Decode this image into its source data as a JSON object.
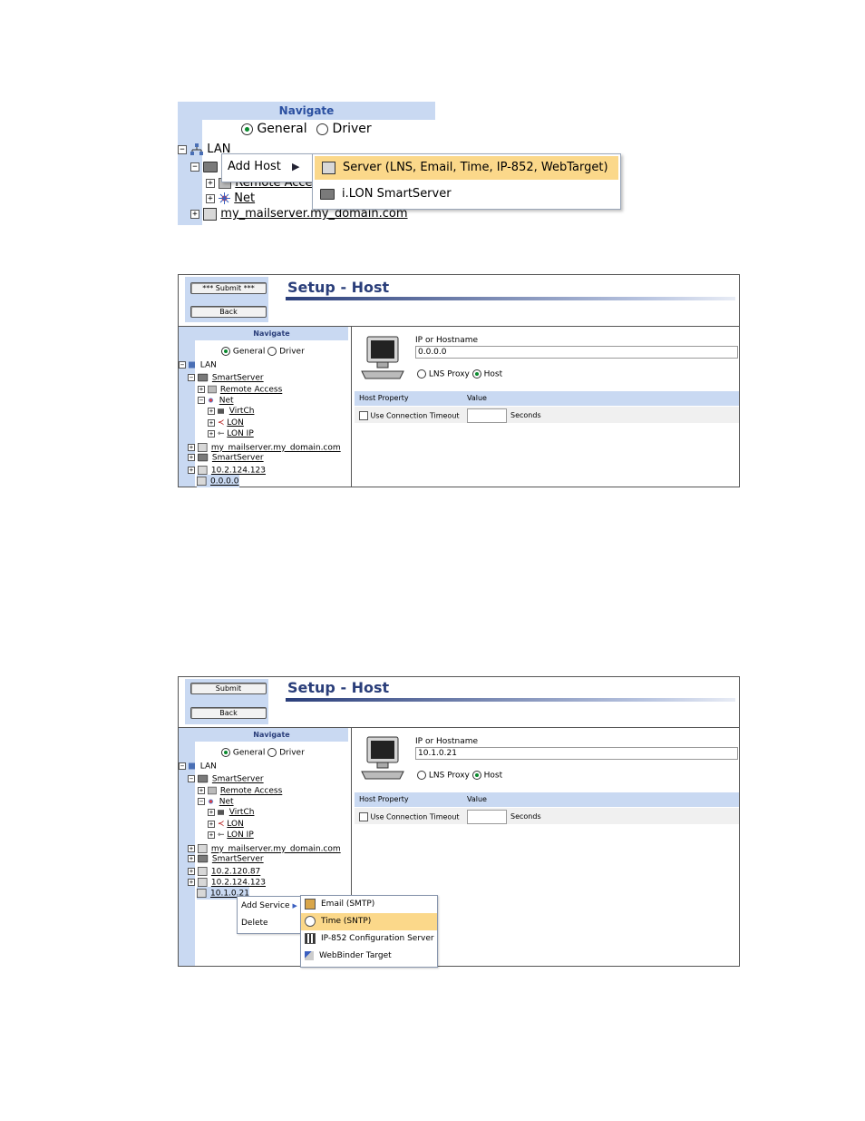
{
  "panel1": {
    "navigate_title": "Navigate",
    "radio_general": "General",
    "radio_driver": "Driver",
    "tree": {
      "lan": "LAN",
      "remote_access_partial": "Remote Acce",
      "net": "Net",
      "mailserver": "my_mailserver.my_domain.com"
    },
    "menu": {
      "add_host": "Add Host"
    },
    "submenu": {
      "server": "Server (LNS, Email, Time, IP-852, WebTarget)",
      "smartserver": "i.LON SmartServer"
    }
  },
  "panel2": {
    "submit_label": "*** Submit ***",
    "back_label": "Back",
    "title": "Setup - Host",
    "navigate_title": "Navigate",
    "radio_general": "General",
    "radio_driver": "Driver",
    "tree": [
      "LAN",
      "SmartServer",
      "Remote Access",
      "Net",
      "VirtCh",
      "LON",
      "LON IP",
      "my_mailserver.my_domain.com",
      "SmartServer",
      "10.2.124.123",
      "0.0.0.0"
    ],
    "ip_label": "IP or Hostname",
    "ip_value": "0.0.0.0",
    "opt_lns": "LNS Proxy",
    "opt_host": "Host",
    "col_property": "Host Property",
    "col_value": "Value",
    "row_label": "Use Connection Timeout",
    "row_unit": "Seconds"
  },
  "panel3": {
    "submit_label": "Submit",
    "back_label": "Back",
    "title": "Setup - Host",
    "navigate_title": "Navigate",
    "radio_general": "General",
    "radio_driver": "Driver",
    "tree": [
      "LAN",
      "SmartServer",
      "Remote Access",
      "Net",
      "VirtCh",
      "LON",
      "LON IP",
      "my_mailserver.my_domain.com",
      "SmartServer",
      "10.2.120.87",
      "10.2.124.123",
      "10.1.0.21"
    ],
    "ip_label": "IP or Hostname",
    "ip_value": "10.1.0.21",
    "opt_lns": "LNS Proxy",
    "opt_host": "Host",
    "col_property": "Host Property",
    "col_value": "Value",
    "row_label": "Use Connection Timeout",
    "row_unit": "Seconds",
    "menu": {
      "add_service": "Add Service",
      "delete": "Delete"
    },
    "submenu": {
      "email": "Email (SMTP)",
      "time": "Time (SNTP)",
      "ip852": "IP-852 Configuration Server",
      "webbinder": "WebBinder Target"
    }
  },
  "colors": {
    "nav_bg": "#c9d9f2",
    "title_blue": "#2a3e7a",
    "menu_highlight": "#fbd88a",
    "radio_on": "#0a8a2e"
  }
}
